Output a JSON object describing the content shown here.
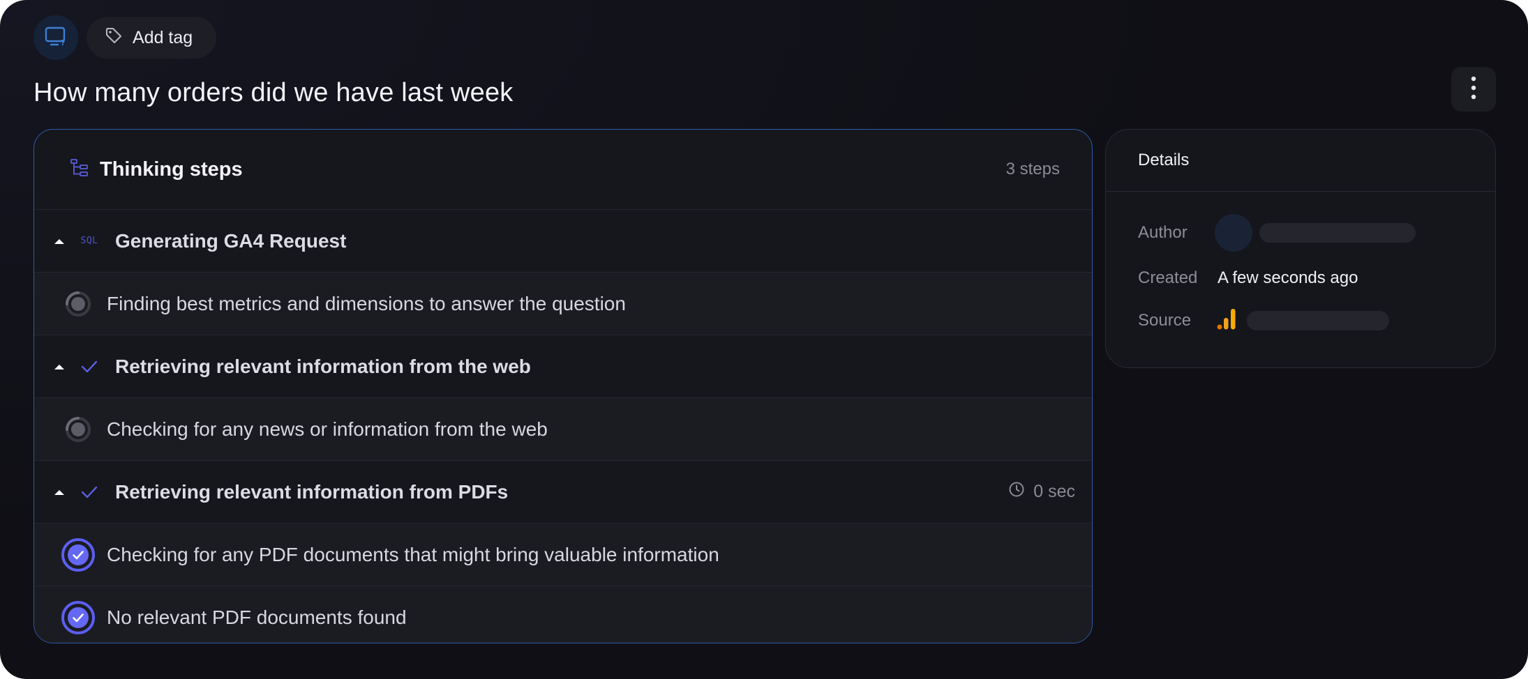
{
  "header": {
    "add_tag_label": "Add tag",
    "title": "How many orders did we have last week"
  },
  "steps_panel": {
    "title": "Thinking steps",
    "count": "3 steps",
    "groups": [
      {
        "label": "Generating GA4 Request",
        "icon": "sql-icon",
        "icon_text": "SQL",
        "time": "",
        "substeps": [
          {
            "label": "Finding best metrics and dimensions to answer the question",
            "status": "pending"
          }
        ]
      },
      {
        "label": "Retrieving relevant information from the web",
        "icon": "check-icon",
        "time": "",
        "substeps": [
          {
            "label": "Checking for any news or information from the web",
            "status": "pending"
          }
        ]
      },
      {
        "label": "Retrieving relevant information from PDFs",
        "icon": "check-icon",
        "time": "0 sec",
        "substeps": [
          {
            "label": "Checking for any PDF documents that might bring valuable information",
            "status": "done"
          },
          {
            "label": "No relevant PDF documents found",
            "status": "done"
          }
        ]
      }
    ]
  },
  "details": {
    "title": "Details",
    "author_label": "Author",
    "created_label": "Created",
    "created_value": "A few seconds ago",
    "source_label": "Source",
    "source_icon": "google-analytics-icon"
  },
  "colors": {
    "background": "#0f0f15",
    "accent": "#5b5ff0",
    "border_active": "#2d5ca8",
    "source_orange": "#f4a21b"
  }
}
